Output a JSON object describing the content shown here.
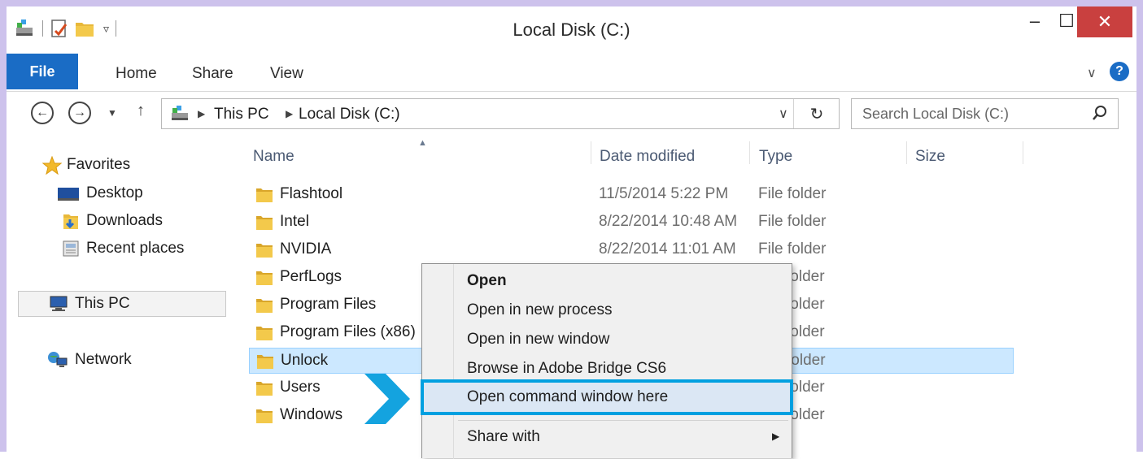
{
  "window": {
    "title": "Local Disk (C:)",
    "controls": {
      "minimize": "–",
      "maximize": "☐",
      "close": "✕"
    }
  },
  "ribbon": {
    "tabs": [
      "File",
      "Home",
      "Share",
      "View"
    ],
    "help": "?"
  },
  "navigation": {
    "breadcrumb": [
      "This PC",
      "Local Disk (C:)"
    ],
    "search_placeholder": "Search Local Disk (C:)"
  },
  "sidebar": {
    "favorites": {
      "label": "Favorites",
      "items": [
        "Desktop",
        "Downloads",
        "Recent places"
      ]
    },
    "this_pc": "This PC",
    "network": "Network"
  },
  "columns": [
    "Name",
    "Date modified",
    "Type",
    "Size"
  ],
  "files": [
    {
      "name": "Flashtool",
      "date": "11/5/2014 5:22 PM",
      "type": "File folder"
    },
    {
      "name": "Intel",
      "date": "8/22/2014 10:48 AM",
      "type": "File folder"
    },
    {
      "name": "NVIDIA",
      "date": "8/22/2014 11:01 AM",
      "type": "File folder"
    },
    {
      "name": "PerfLogs",
      "date": "",
      "type": "folder"
    },
    {
      "name": "Program Files",
      "date": "",
      "type": "folder"
    },
    {
      "name": "Program Files (x86)",
      "date": "",
      "type": "folder"
    },
    {
      "name": "Unlock",
      "date": "",
      "type": "folder",
      "selected": true
    },
    {
      "name": "Users",
      "date": "",
      "type": "folder"
    },
    {
      "name": "Windows",
      "date": "",
      "type": "folder"
    }
  ],
  "context_menu": {
    "items": [
      "Open",
      "Open in new process",
      "Open in new window",
      "Browse in Adobe Bridge CS6",
      "Open command window here",
      "Share with"
    ],
    "highlighted": "Open command window here"
  },
  "colors": {
    "accent": "#1a6cc5",
    "close_button": "#c9403f",
    "selection": "#cce8ff",
    "highlight_outline": "#00a0e0",
    "window_border": "#cdc2ec",
    "folder": "#e8b83a"
  },
  "icons": {
    "quick_access": [
      "drive-icon",
      "properties-icon",
      "new-folder-icon",
      "customize-dropdown-icon"
    ],
    "navigation": [
      "back-arrow-icon",
      "forward-arrow-icon",
      "recent-locations-icon",
      "up-arrow-icon"
    ],
    "pointer": "chevron-pointer-icon"
  }
}
